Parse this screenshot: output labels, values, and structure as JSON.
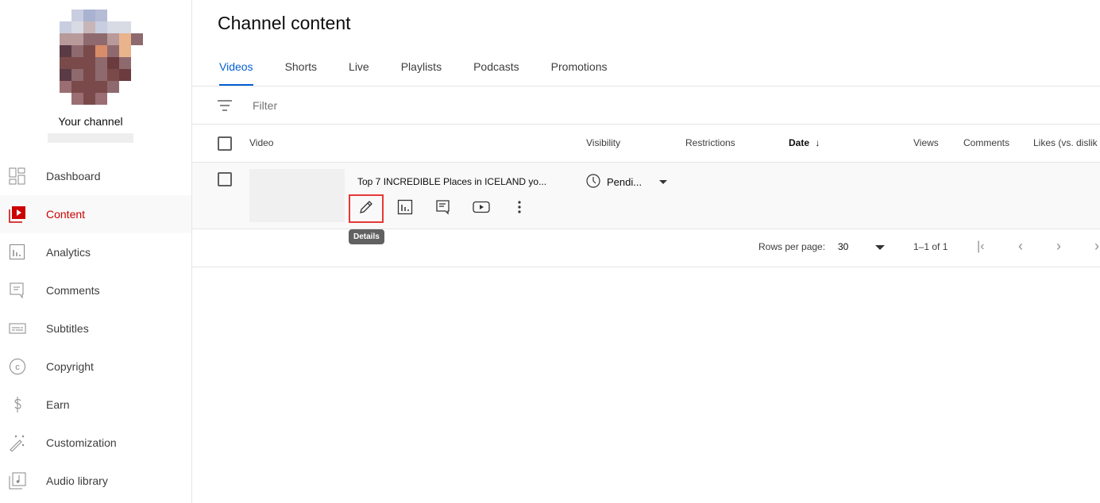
{
  "sidebar": {
    "channel_label": "Your channel",
    "items": [
      {
        "label": "Dashboard",
        "icon": "dashboard-icon"
      },
      {
        "label": "Content",
        "icon": "content-icon",
        "active": true
      },
      {
        "label": "Analytics",
        "icon": "analytics-icon"
      },
      {
        "label": "Comments",
        "icon": "comments-icon"
      },
      {
        "label": "Subtitles",
        "icon": "subtitles-icon"
      },
      {
        "label": "Copyright",
        "icon": "copyright-icon"
      },
      {
        "label": "Earn",
        "icon": "earn-icon"
      },
      {
        "label": "Customization",
        "icon": "customization-icon"
      },
      {
        "label": "Audio library",
        "icon": "audio-library-icon"
      }
    ]
  },
  "header": {
    "title": "Channel content"
  },
  "tabs": [
    {
      "label": "Videos",
      "active": true
    },
    {
      "label": "Shorts"
    },
    {
      "label": "Live"
    },
    {
      "label": "Playlists"
    },
    {
      "label": "Podcasts"
    },
    {
      "label": "Promotions"
    }
  ],
  "filter": {
    "placeholder": "Filter"
  },
  "table": {
    "columns": {
      "video": "Video",
      "visibility": "Visibility",
      "restrictions": "Restrictions",
      "date": "Date",
      "views": "Views",
      "comments": "Comments",
      "likes": "Likes (vs. dislik"
    },
    "rows": [
      {
        "title": "Top 7 INCREDIBLE Places in ICELAND yo...",
        "visibility": "Pendi..."
      }
    ],
    "tooltip": "Details"
  },
  "pagination": {
    "rows_label": "Rows per page:",
    "rows_value": "30",
    "range": "1–1 of 1"
  },
  "colors": {
    "accent": "#065fd4",
    "active_nav": "#cc0000",
    "highlight_box": "#e53935"
  }
}
